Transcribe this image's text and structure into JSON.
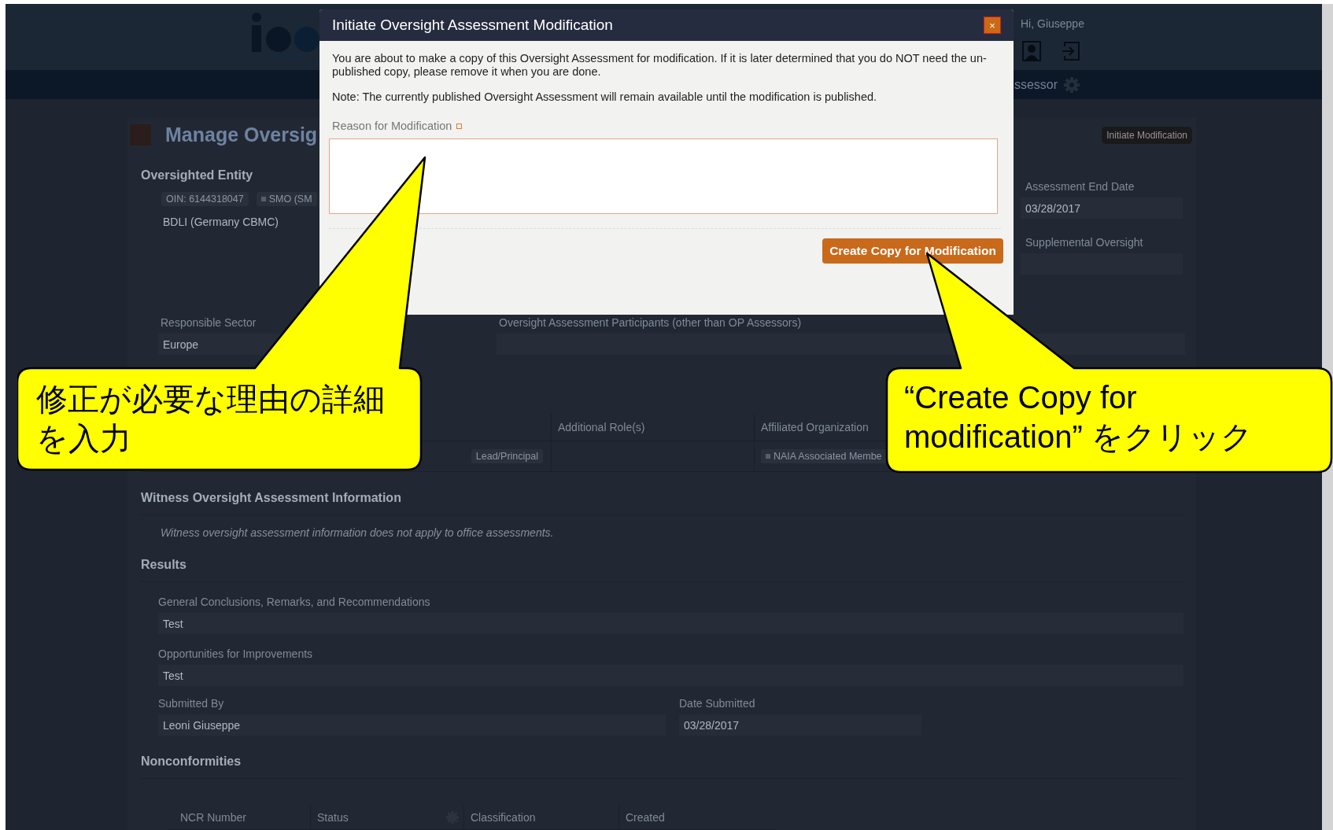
{
  "header": {
    "greeting": "Hi, Giuseppe"
  },
  "nav": {
    "role_label": "ssessor"
  },
  "page": {
    "title": "Manage Oversig",
    "action_button": "Initiate Modification"
  },
  "entity": {
    "heading": "Oversighted Entity",
    "oin_chip": "OIN: 6144318047",
    "type_chip": "SMO (SM",
    "name": "BDLI (Germany CBMC)"
  },
  "dates": [
    {
      "label": "Assessment End Date",
      "value": "03/28/2017"
    },
    {
      "label": "Supplemental Oversight"
    }
  ],
  "sector": {
    "label": "Responsible Sector",
    "value": "Europe"
  },
  "participants": {
    "label": "Oversight Assessment Participants (other than OP Assessors)",
    "columns": [
      "Additional Role(s)",
      "Affiliated Organization"
    ],
    "role_chip": "Lead/Principal",
    "organization_chip": "NAIA Associated Membe"
  },
  "witness": {
    "heading": "Witness Oversight Assessment Information",
    "note": "Witness oversight assessment information does not apply to office assessments."
  },
  "results": {
    "heading": "Results",
    "fields": [
      {
        "label": "General Conclusions, Remarks, and Recommendations",
        "value": "Test"
      },
      {
        "label": "Opportunities for Improvements",
        "value": "Test"
      }
    ],
    "submitted": [
      {
        "label": "Submitted By",
        "value": "Leoni Giuseppe"
      },
      {
        "label": "Date Submitted",
        "value": "03/28/2017"
      }
    ]
  },
  "nonconformities": {
    "heading": "Nonconformities",
    "columns": [
      {
        "label": "NCR Number",
        "kind": "plain"
      },
      {
        "label": "Status",
        "kind": "settings"
      },
      {
        "label": "Classification",
        "kind": "plain"
      },
      {
        "label": "Created",
        "kind": "plain"
      }
    ]
  },
  "dialog": {
    "title": "Initiate Oversight Assessment Modification",
    "close": "×",
    "paragraphs": [
      "You are about to make a copy of this Oversight Assessment for modification. If it is later determined that you do NOT need the un-published copy, please remove it when you are done.",
      "Note: The currently published Oversight Assessment will remain available until the modification is published."
    ],
    "field_label": "Reason for Modification",
    "required": true,
    "button": "Create Copy for Modification"
  },
  "callouts": [
    {
      "text": "修正が必要な理由の詳細を入力"
    },
    {
      "text": "“Create Copy for modification” をクリック"
    }
  ]
}
